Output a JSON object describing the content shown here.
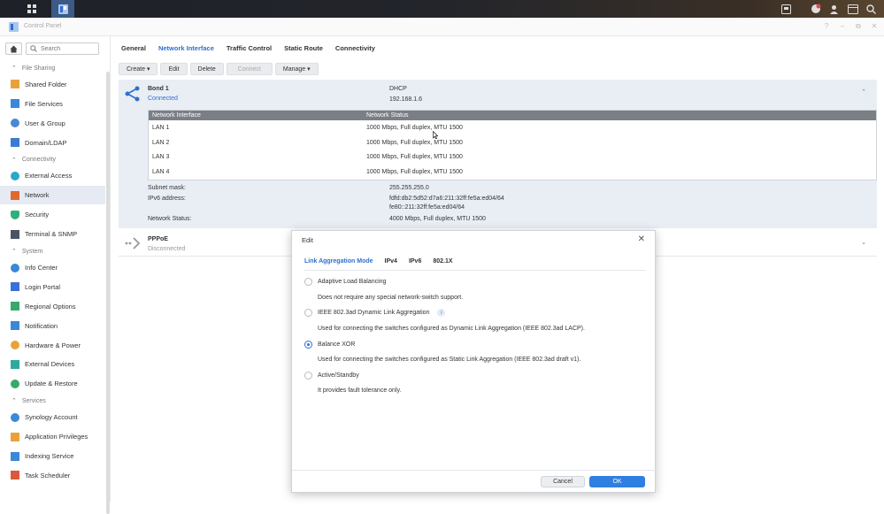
{
  "window": {
    "title": "Control Panel"
  },
  "search": {
    "placeholder": "Search"
  },
  "sidebar": {
    "sections": [
      {
        "label": "File Sharing",
        "items": [
          "Shared Folder",
          "File Services",
          "User & Group",
          "Domain/LDAP"
        ]
      },
      {
        "label": "Connectivity",
        "items": [
          "External Access",
          "Network",
          "Security",
          "Terminal & SNMP"
        ]
      },
      {
        "label": "System",
        "items": [
          "Info Center",
          "Login Portal",
          "Regional Options",
          "Notification",
          "Hardware & Power",
          "External Devices",
          "Update & Restore"
        ]
      },
      {
        "label": "Services",
        "items": [
          "Synology Account",
          "Application Privileges",
          "Indexing Service",
          "Task Scheduler"
        ]
      }
    ],
    "active": "Network"
  },
  "tabs": [
    "General",
    "Network Interface",
    "Traffic Control",
    "Static Route",
    "Connectivity"
  ],
  "active_tab": "Network Interface",
  "toolbar": {
    "create": "Create",
    "edit": "Edit",
    "delete": "Delete",
    "connect": "Connect",
    "manage": "Manage"
  },
  "bond": {
    "name": "Bond 1",
    "status": "Connected",
    "mode": "DHCP",
    "ip": "192.168.1.6",
    "table_headers": [
      "Network Interface",
      "Network Status"
    ],
    "rows": [
      {
        "iface": "LAN 1",
        "status": "1000 Mbps, Full duplex, MTU 1500"
      },
      {
        "iface": "LAN 2",
        "status": "1000 Mbps, Full duplex, MTU 1500"
      },
      {
        "iface": "LAN 3",
        "status": "1000 Mbps, Full duplex, MTU 1500"
      },
      {
        "iface": "LAN 4",
        "status": "1000 Mbps, Full duplex, MTU 1500"
      }
    ],
    "subnet_label": "Subnet mask:",
    "subnet": "255.255.255.0",
    "ipv6_label": "IPv6 address:",
    "ipv6_1": "fdfd:db2:5d52:d7a6:211:32ff:fe5a:ed04/64",
    "ipv6_2": "fe80::211:32ff:fe5a:ed04/64",
    "netstatus_label": "Network Status:",
    "netstatus": "4000 Mbps, Full duplex, MTU 1500"
  },
  "pppoe": {
    "name": "PPPoE",
    "status": "Disconnected"
  },
  "dialog": {
    "title": "Edit",
    "tabs": [
      "Link Aggregation Mode",
      "IPv4",
      "IPv6",
      "802.1X"
    ],
    "active_tab": "Link Aggregation Mode",
    "options": [
      {
        "label": "Adaptive Load Balancing",
        "desc": "Does not require any special network-switch support.",
        "checked": false
      },
      {
        "label": "IEEE 802.3ad Dynamic Link Aggregation",
        "desc": "Used for connecting the switches configured as Dynamic Link Aggregation (IEEE 802.3ad LACP).",
        "checked": false
      },
      {
        "label": "Balance XOR",
        "desc": "Used for connecting the switches configured as Static Link Aggregation (IEEE 802.3ad draft v1).",
        "checked": true
      },
      {
        "label": "Active/Standby",
        "desc": "It provides fault tolerance only.",
        "checked": false
      }
    ],
    "cancel": "Cancel",
    "ok": "OK"
  },
  "colors": {
    "accent": "#2f6fd0",
    "ok_button": "#2f7fe0",
    "panel_bg": "#e9eef5"
  }
}
